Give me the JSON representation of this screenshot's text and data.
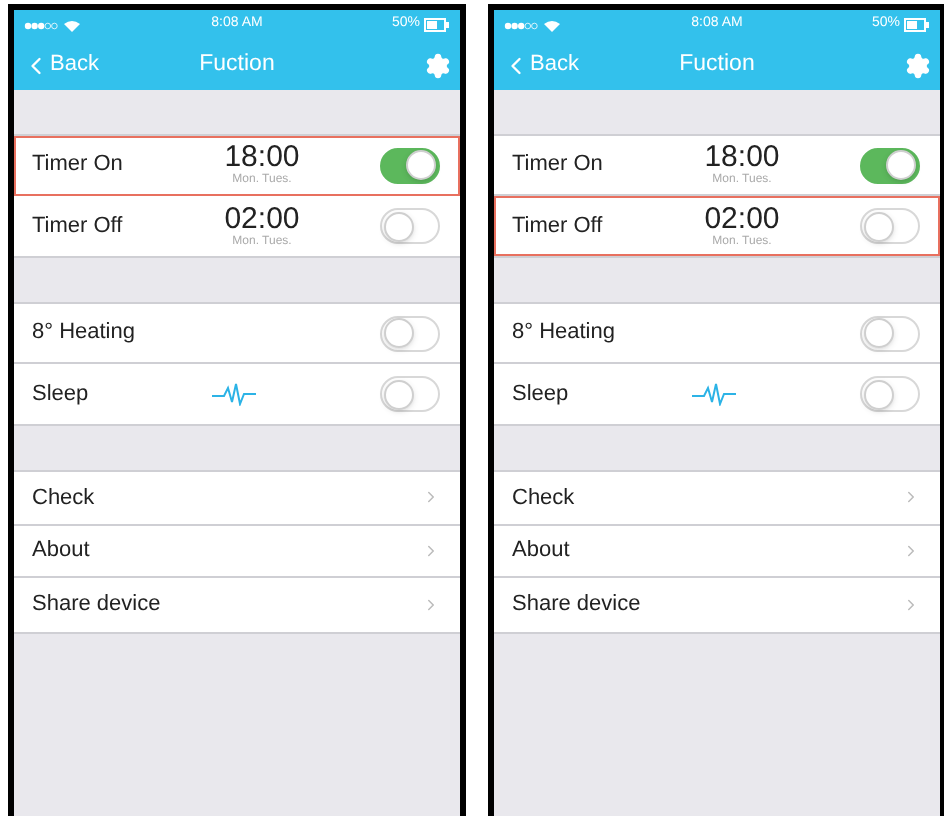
{
  "screens": [
    {
      "status_bar": {
        "time": "8:08 AM",
        "battery": "50%"
      },
      "nav": {
        "back": "Back",
        "title": "Fuction"
      },
      "sections": [
        {
          "rows": [
            {
              "kind": "timer",
              "label": "Timer On",
              "time": "18:00",
              "days": "Mon. Tues.",
              "on": true,
              "highlighted": true
            },
            {
              "kind": "timer",
              "label": "Timer Off",
              "time": "02:00",
              "days": "Mon. Tues.",
              "on": false,
              "highlighted": false
            }
          ]
        },
        {
          "rows": [
            {
              "kind": "toggle",
              "label": "8° Heating",
              "on": false
            },
            {
              "kind": "sleep",
              "label": "Sleep",
              "on": false
            }
          ]
        },
        {
          "rows": [
            {
              "kind": "link",
              "label": "Check"
            },
            {
              "kind": "link",
              "label": "About"
            },
            {
              "kind": "link",
              "label": "Share device"
            }
          ]
        }
      ]
    },
    {
      "status_bar": {
        "time": "8:08 AM",
        "battery": "50%"
      },
      "nav": {
        "back": "Back",
        "title": "Fuction"
      },
      "sections": [
        {
          "rows": [
            {
              "kind": "timer",
              "label": "Timer On",
              "time": "18:00",
              "days": "Mon. Tues.",
              "on": true,
              "highlighted": false
            },
            {
              "kind": "timer",
              "label": "Timer Off",
              "time": "02:00",
              "days": "Mon. Tues.",
              "on": false,
              "highlighted": true
            }
          ]
        },
        {
          "rows": [
            {
              "kind": "toggle",
              "label": "8° Heating",
              "on": false
            },
            {
              "kind": "sleep",
              "label": "Sleep",
              "on": false
            }
          ]
        },
        {
          "rows": [
            {
              "kind": "link",
              "label": "Check"
            },
            {
              "kind": "link",
              "label": "About"
            },
            {
              "kind": "link",
              "label": "Share device"
            }
          ]
        }
      ]
    }
  ]
}
